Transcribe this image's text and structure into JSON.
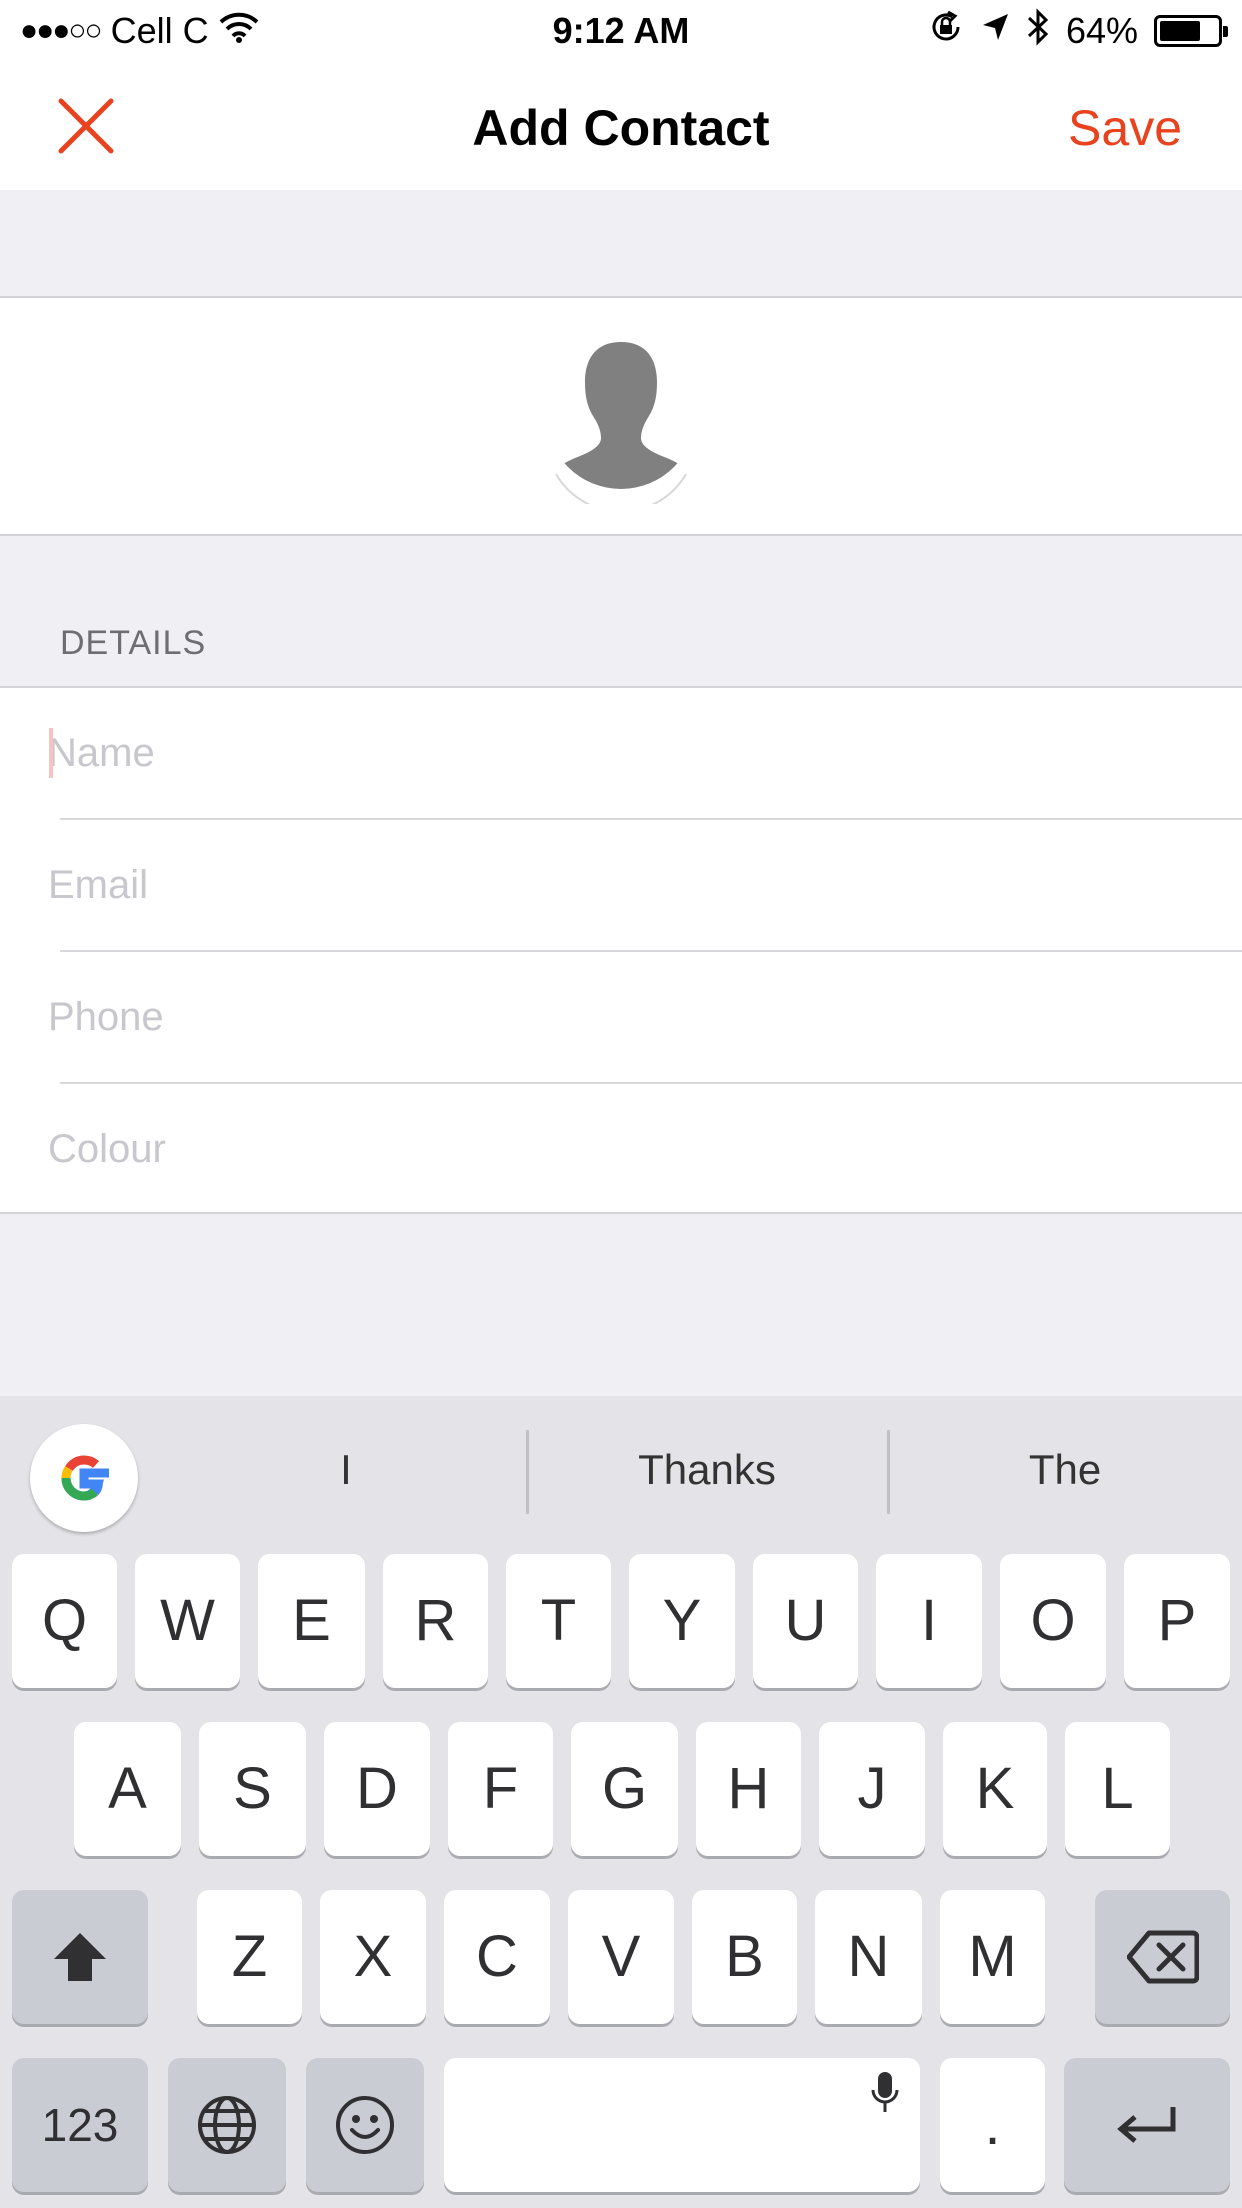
{
  "status_bar": {
    "signal": "●●●○○",
    "carrier": "Cell C",
    "time": "9:12 AM",
    "battery_percent": "64%",
    "battery_level": 0.64,
    "icons": [
      "wifi-icon",
      "rotation-lock-icon",
      "location-arrow-icon",
      "bluetooth-icon",
      "battery-icon"
    ]
  },
  "nav": {
    "title": "Add Contact",
    "save_label": "Save",
    "close_icon": "close-icon",
    "accent_color": "#e8431e"
  },
  "avatar": {
    "icon": "person-silhouette-icon"
  },
  "details": {
    "header": "DETAILS",
    "fields": [
      {
        "name": "name",
        "placeholder": "Name",
        "value": ""
      },
      {
        "name": "email",
        "placeholder": "Email",
        "value": ""
      },
      {
        "name": "phone",
        "placeholder": "Phone",
        "value": ""
      },
      {
        "name": "colour",
        "placeholder": "Colour",
        "value": ""
      }
    ]
  },
  "keyboard": {
    "suggestions": [
      "I",
      "Thanks",
      "The"
    ],
    "row1": [
      "Q",
      "W",
      "E",
      "R",
      "T",
      "Y",
      "U",
      "I",
      "O",
      "P"
    ],
    "row2": [
      "A",
      "S",
      "D",
      "F",
      "G",
      "H",
      "J",
      "K",
      "L"
    ],
    "row3": [
      "Z",
      "X",
      "C",
      "V",
      "B",
      "N",
      "M"
    ],
    "numbers_label": "123",
    "period_label": ".",
    "icons": [
      "google-icon",
      "shift-icon",
      "backspace-icon",
      "globe-icon",
      "emoji-icon",
      "microphone-icon",
      "return-icon"
    ]
  }
}
